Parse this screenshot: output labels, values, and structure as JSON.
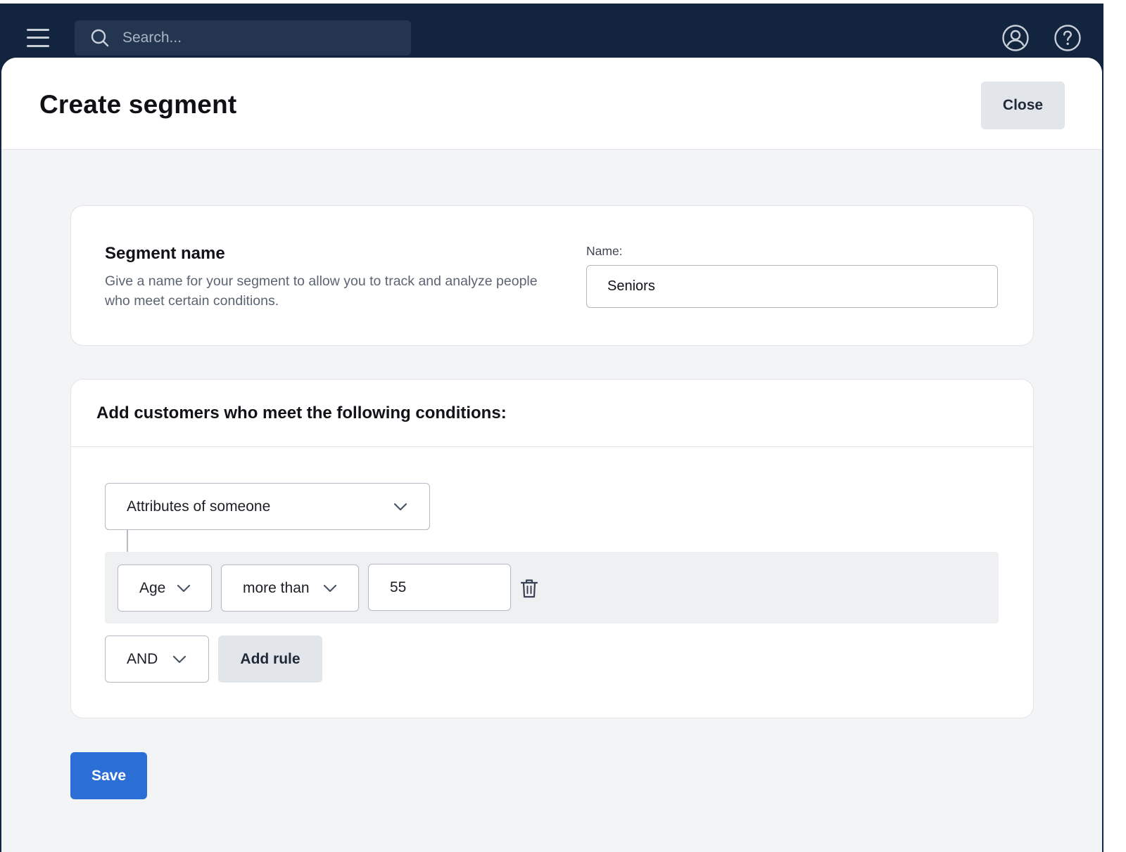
{
  "topbar": {
    "search_placeholder": "Search..."
  },
  "modal": {
    "title": "Create segment",
    "close_label": "Close"
  },
  "segment_name_section": {
    "title": "Segment name",
    "description": "Give a name for your segment to allow you to track and analyze people who meet certain conditions.",
    "field_label": "Name:",
    "field_value": "Seniors"
  },
  "conditions_section": {
    "title": "Add customers who meet the following conditions:",
    "condition_type": "Attributes of someone",
    "rule": {
      "attribute": "Age",
      "operator": "more than",
      "value": "55"
    },
    "logic_operator": "AND",
    "add_rule_label": "Add rule"
  },
  "footer": {
    "save_label": "Save"
  },
  "colors": {
    "nav_background": "#13253e",
    "primary_button": "#2b6fd6",
    "secondary_button": "#e2e5e9",
    "page_background": "#f3f4f6"
  }
}
